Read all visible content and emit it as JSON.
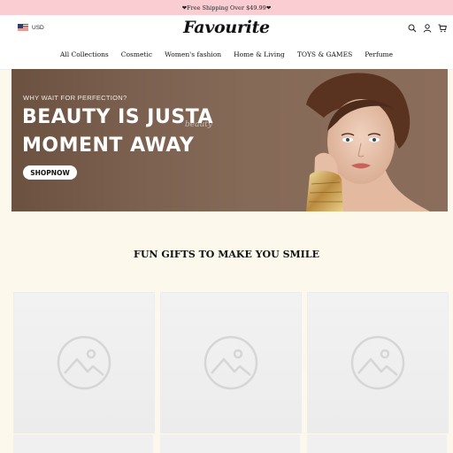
{
  "announcement": "❤Free Shipping Over $49.99❤",
  "header": {
    "currency": "USD",
    "logo": "Favourite",
    "icons": [
      "search-icon",
      "account-icon",
      "cart-icon"
    ]
  },
  "nav": {
    "items": [
      {
        "label": "All Collections"
      },
      {
        "label": "Cosmetic"
      },
      {
        "label": "Women's fashion"
      },
      {
        "label": "Home & Living"
      },
      {
        "label": "TOYS & GAMES"
      },
      {
        "label": "Perfume"
      }
    ]
  },
  "hero": {
    "subtitle": "WHY WAIT FOR PERFECTION?",
    "title_line1": "BEAUTY IS JUSTA",
    "title_line2": "MOMENT AWAY",
    "script": "beauty",
    "button": "SHOPNOW"
  },
  "section": {
    "title": "FUN GIFTS TO MAKE YOU SMILE"
  },
  "products": [
    {
      "image": "image-placeholder-icon"
    },
    {
      "image": "image-placeholder-icon"
    },
    {
      "image": "image-placeholder-icon"
    }
  ],
  "colors": {
    "announcement_bg": "#f9cdd1",
    "page_bg": "#fcf8ec",
    "hero_bg": "#7d6150"
  }
}
